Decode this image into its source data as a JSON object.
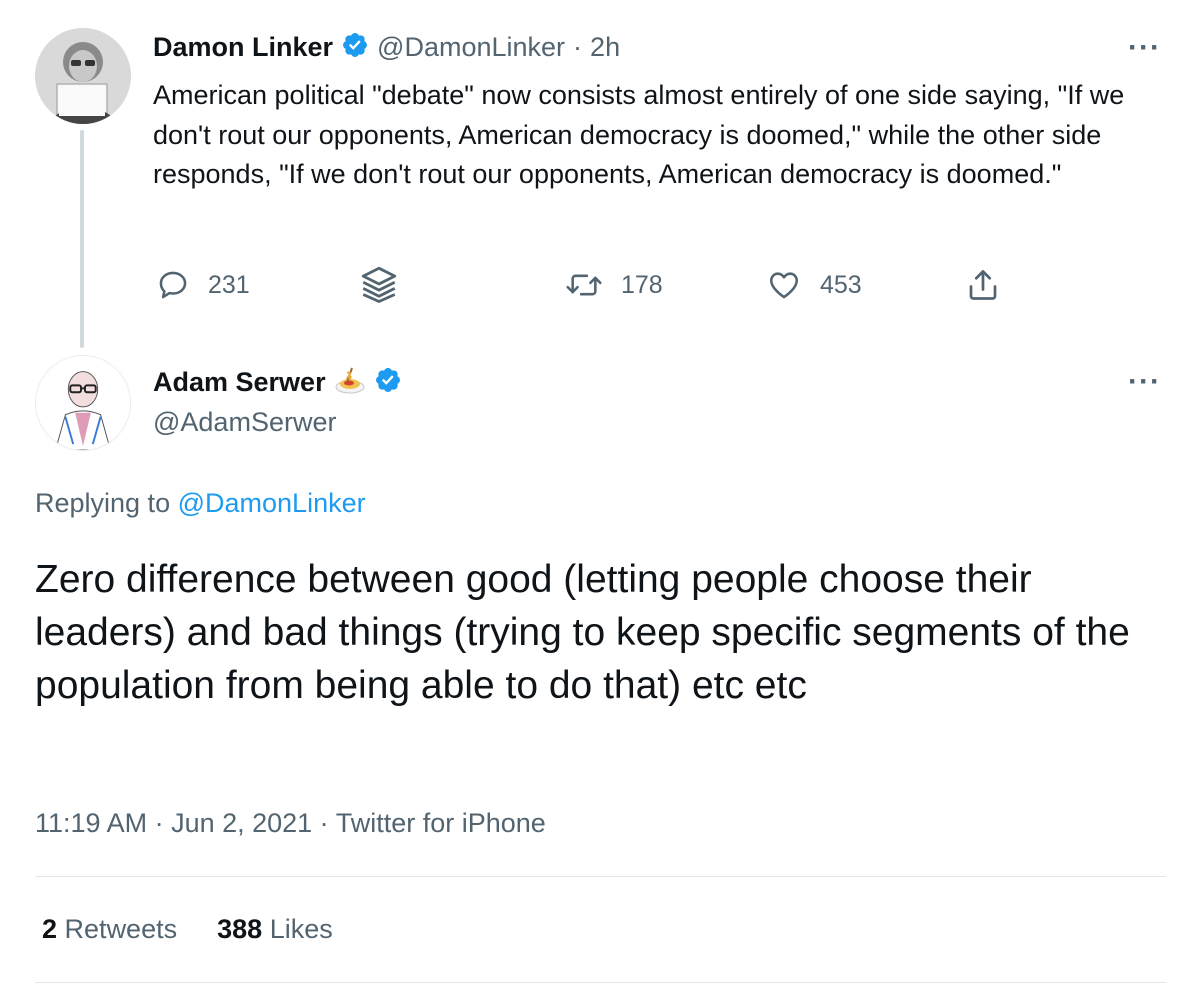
{
  "parent_tweet": {
    "author_name": "Damon Linker",
    "author_handle": "@DamonLinker",
    "separator": "·",
    "time_ago": "2h",
    "text": "American political \"debate\" now consists almost entirely of one side saying, \"If we don't rout our opponents, American democracy is doomed,\" while the other side responds, \"If we don't rout our opponents, American democracy is doomed.\"",
    "reply_count": "231",
    "retweet_count": "178",
    "like_count": "453",
    "more_label": "···"
  },
  "main_tweet": {
    "author_name": "Adam Serwer",
    "author_emoji": "🍝",
    "author_handle": "@AdamSerwer",
    "more_label": "···",
    "replying_prefix": "Replying to",
    "replying_handle": "@DamonLinker",
    "text": "Zero difference between good (letting people choose their leaders) and bad things (trying to keep specific segments of the population from being able to do that) etc etc",
    "timestamp": "11:19 AM · Jun 2, 2021 · Twitter for iPhone",
    "retweets_count": "2",
    "retweets_label": "Retweets",
    "likes_count": "388",
    "likes_label": "Likes"
  },
  "colors": {
    "text_primary": "#0f1419",
    "text_secondary": "#536471",
    "accent": "#1d9bf0",
    "verified_badge": "#1d9bf0",
    "divider": "#e1e8ed"
  },
  "icons": [
    "verified-badge-icon",
    "reply-icon",
    "thread-stack-icon",
    "retweet-icon",
    "like-icon",
    "share-icon",
    "more-icon"
  ]
}
